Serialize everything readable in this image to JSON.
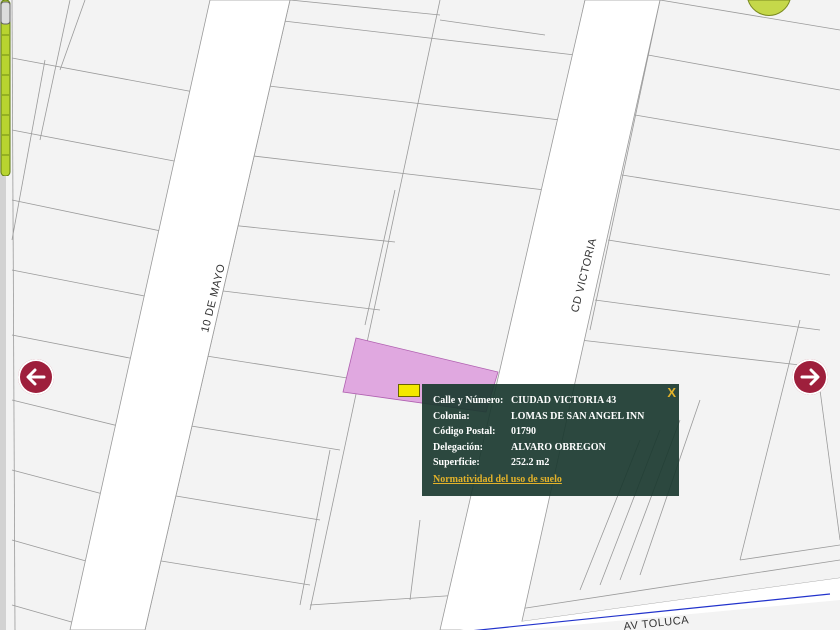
{
  "streets": {
    "diez_de_mayo": "10 DE MAYO",
    "cd_victoria": "CD VICTORIA",
    "av_toluca": "AV TOLUCA"
  },
  "popup": {
    "close_label": "X",
    "fields": [
      {
        "label": "Calle y Número:",
        "value": "CIUDAD VICTORIA 43"
      },
      {
        "label": "Colonia:",
        "value": "LOMAS DE SAN ANGEL INN"
      },
      {
        "label": "Código Postal:",
        "value": "01790"
      },
      {
        "label": "Delegación:",
        "value": "ALVARO OBREGON"
      },
      {
        "label": "Superficie:",
        "value": "252.2 m2"
      }
    ],
    "link_label": "Normatividad del uso de suelo"
  },
  "icons": {
    "prev": "arrow-left-icon",
    "next": "arrow-right-icon",
    "marker": "location-marker-icon"
  },
  "colors": {
    "highlight_parcel": "#e0a8e0",
    "popup_bg": "#1c3a30",
    "link": "#e3b22a",
    "arrow": "#9e1f3c",
    "zoom_bar": "#b8d430",
    "avenue_line": "#2233cc"
  }
}
